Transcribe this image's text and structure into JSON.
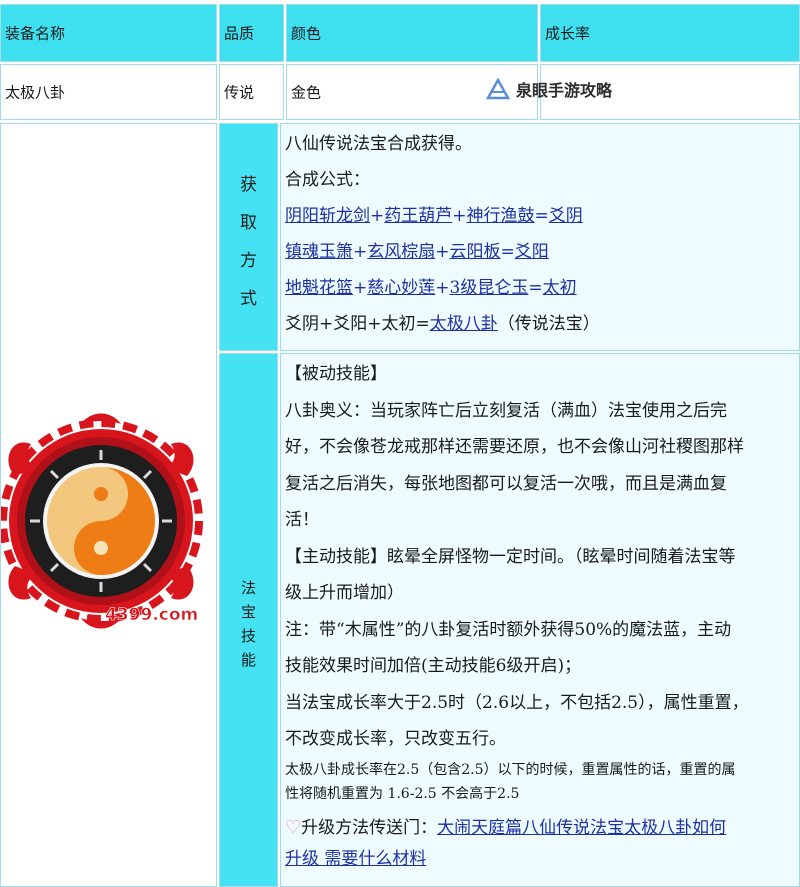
{
  "headers": {
    "name": "装备名称",
    "quality": "品质",
    "color": "颜色",
    "growth": "成长率"
  },
  "item": {
    "name": "太极八卦",
    "quality": "传说",
    "color": "金色",
    "growth": ""
  },
  "watermark": {
    "text": "泉眼手游攻略"
  },
  "image": {
    "logo_text": "4399.com"
  },
  "acquire": {
    "label_chars": [
      "获",
      "取",
      "方",
      "式"
    ],
    "line1": "八仙传说法宝合成获得。",
    "line2": "合成公式：",
    "recipe1": {
      "a": "阴阳斩龙剑",
      "b": "药王葫芦",
      "c": "神行渔鼓",
      "result": "爻阴"
    },
    "recipe2": {
      "a": "镇魂玉箫",
      "b": "玄风棕扇",
      "c": "云阳板",
      "result": "爻阳"
    },
    "recipe3": {
      "a": "地魁花篮",
      "b": "慈心妙莲",
      "c": "3级昆仑玉",
      "result": "太初"
    },
    "recipe4": {
      "prefix": "爻阴+爻阳+太初=",
      "result": "太极八卦",
      "suffix": "（传说法宝）"
    }
  },
  "skill": {
    "label_chars": [
      "法",
      "宝",
      "技",
      "能"
    ],
    "passive_title": "【被动技能】",
    "passive_l1": "八卦奥义：当玩家阵亡后立刻复活（满血）法宝使用之后完",
    "passive_l2": "好，不会像苍龙戒那样还需要还原，也不会像山河社稷图那样",
    "passive_l3": "复活之后消失，每张地图都可以复活一次哦，而且是满血复",
    "passive_l4": "活！",
    "active_l1": "【主动技能】眩晕全屏怪物一定时间。（眩晕时间随着法宝等",
    "active_l2": "级上升而增加）",
    "note_l1": "注：带“木属性”的八卦复活时额外获得50%的魔法蓝，主动",
    "note_l2": "技能效果时间加倍(主动技能6级开启)；",
    "growth_l1": "当法宝成长率大于2.5时（2.6以上，不包括2.5），属性重置，",
    "growth_l2": "不改变成长率，只改变五行。",
    "small_l1": "太极八卦成长率在2.5（包含2.5）以下的时候，重置属性的话，重置的属",
    "small_l2": "性将随机重置为 1.6-2.5 不会高于2.5",
    "upgrade_label": "升级方法传送门：",
    "upgrade_link_1": "大闹天庭篇八仙传说法宝太极八卦如何",
    "upgrade_link_2": "升级  需要什么材料"
  },
  "colors": {
    "header_bg": "#3ee0f0",
    "label_bg": "#44e2f2",
    "body_bg": "#eefcff",
    "link": "#1c2fa6"
  }
}
